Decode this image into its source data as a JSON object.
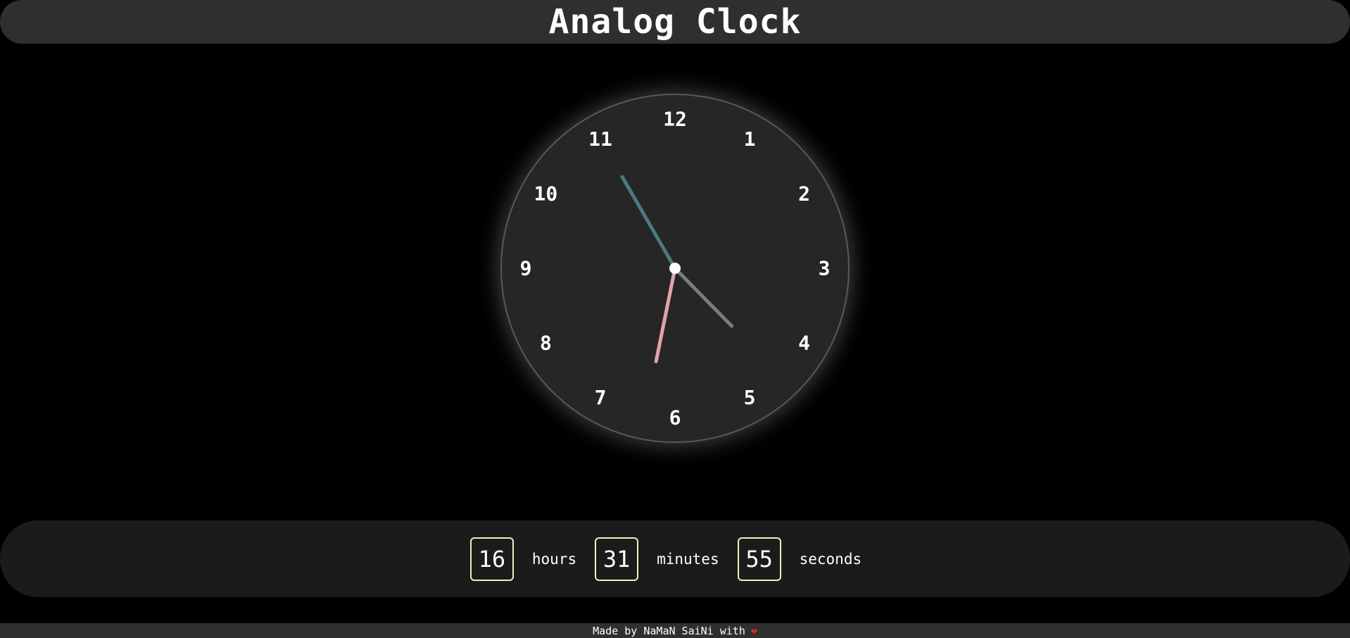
{
  "header": {
    "title": "Analog Clock"
  },
  "clock": {
    "numerals": [
      "12",
      "1",
      "2",
      "3",
      "4",
      "5",
      "6",
      "7",
      "8",
      "9",
      "10",
      "11"
    ],
    "time": {
      "hours": 16,
      "minutes": 31,
      "seconds": 55
    },
    "colors": {
      "hour_hand": "#7c7c7c",
      "minute_hand": "#e0a4ab",
      "second_hand": "#4c7a7e",
      "center_dot": "#ffffff",
      "face": "#262626"
    }
  },
  "digital": {
    "hours_value": "16",
    "hours_label": "hours",
    "minutes_value": "31",
    "minutes_label": "minutes",
    "seconds_value": "55",
    "seconds_label": "seconds",
    "box_border_color": "#f3efb6"
  },
  "footer": {
    "text": "Made by NaMaN SaiNi with",
    "icon": "heart-icon"
  }
}
